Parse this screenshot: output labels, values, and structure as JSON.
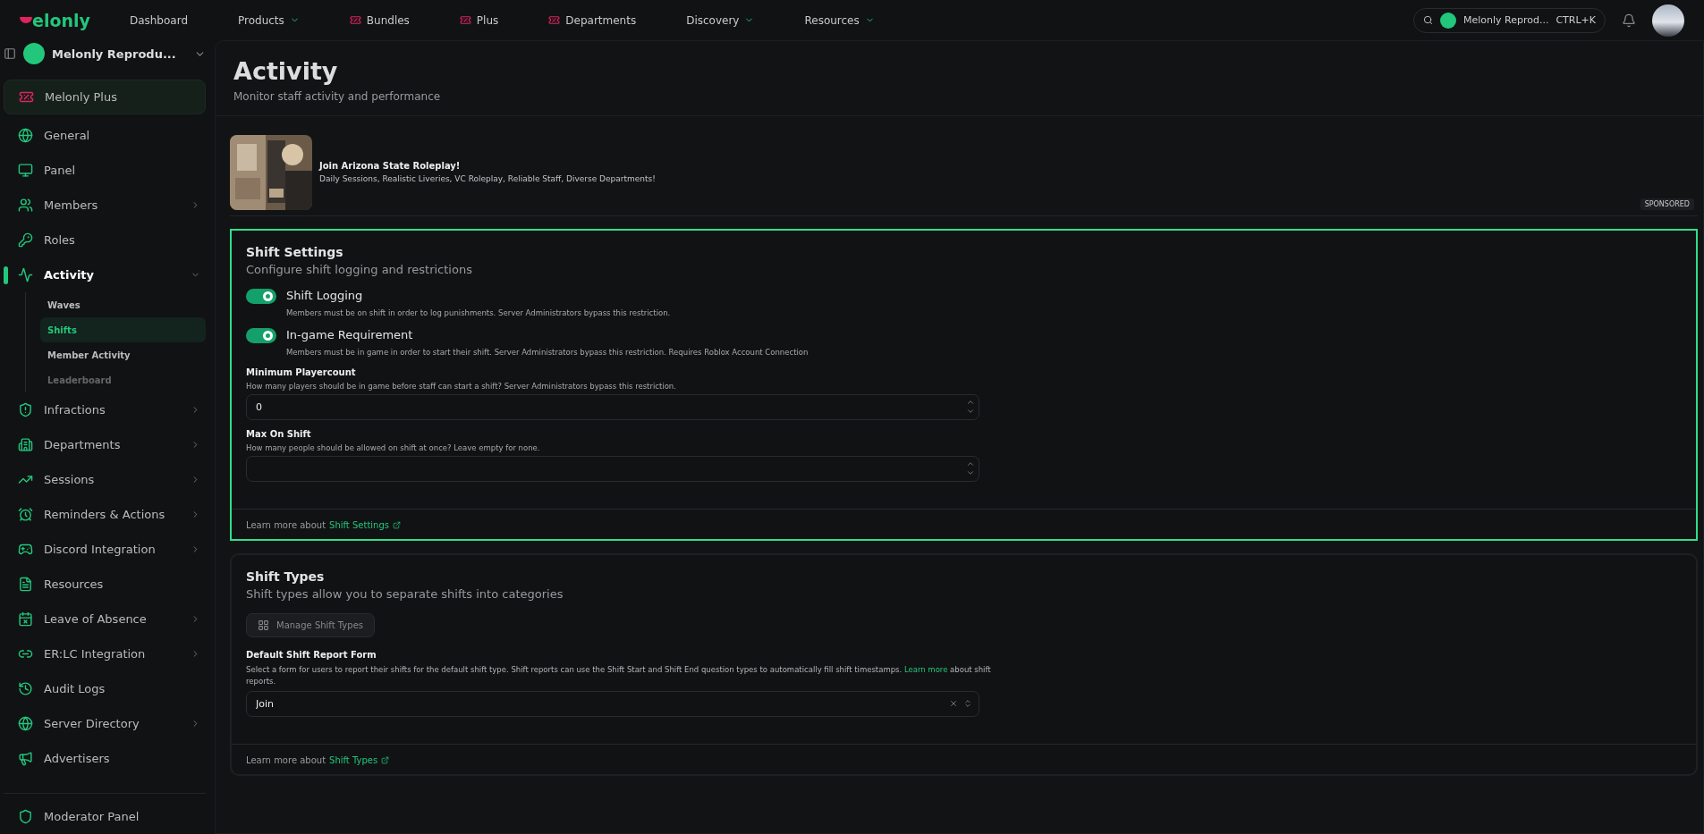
{
  "nav": {
    "logo_text": "elonly",
    "items": [
      {
        "label": "Dashboard",
        "kind": "link"
      },
      {
        "label": "Products",
        "kind": "menu"
      },
      {
        "label": "Bundles",
        "kind": "featured"
      },
      {
        "label": "Plus",
        "kind": "featured"
      },
      {
        "label": "Departments",
        "kind": "featured"
      },
      {
        "label": "Discovery",
        "kind": "menu"
      },
      {
        "label": "Resources",
        "kind": "menu"
      }
    ],
    "server_switcher": {
      "name": "Melonly Reprod...",
      "shortcut": "CTRL+K"
    }
  },
  "sidebar": {
    "server": "Melonly Reprodu...",
    "items": [
      {
        "label": "Melonly Plus",
        "kind": "promo",
        "selected": false
      },
      {
        "label": "General",
        "kind": "link",
        "selected": false
      },
      {
        "label": "Panel",
        "kind": "link",
        "selected": false
      },
      {
        "label": "Members",
        "kind": "group",
        "expanded": false,
        "selected": false
      },
      {
        "label": "Roles",
        "kind": "link",
        "selected": false
      },
      {
        "label": "Activity",
        "kind": "group",
        "expanded": true,
        "selected": true,
        "children": [
          {
            "label": "Waves",
            "selected": false,
            "disabled": false
          },
          {
            "label": "Shifts",
            "selected": true,
            "disabled": false
          },
          {
            "label": "Member Activity",
            "selected": false,
            "disabled": false
          },
          {
            "label": "Leaderboard",
            "selected": false,
            "disabled": true
          }
        ]
      },
      {
        "label": "Infractions",
        "kind": "group",
        "expanded": false,
        "selected": false
      },
      {
        "label": "Departments",
        "kind": "group",
        "expanded": false,
        "selected": false
      },
      {
        "label": "Sessions",
        "kind": "group",
        "expanded": false,
        "selected": false
      },
      {
        "label": "Reminders & Actions",
        "kind": "group",
        "expanded": false,
        "selected": false
      },
      {
        "label": "Discord Integration",
        "kind": "group",
        "expanded": false,
        "selected": false
      },
      {
        "label": "Resources",
        "kind": "link",
        "selected": false
      },
      {
        "label": "Leave of Absence",
        "kind": "group",
        "expanded": false,
        "selected": false
      },
      {
        "label": "ER:LC Integration",
        "kind": "group",
        "expanded": false,
        "selected": false
      },
      {
        "label": "Audit Logs",
        "kind": "link",
        "selected": false
      },
      {
        "label": "Server Directory",
        "kind": "group",
        "expanded": false,
        "selected": false
      },
      {
        "label": "Advertisers",
        "kind": "link",
        "selected": false
      }
    ],
    "footer": "Moderator Panel"
  },
  "page": {
    "title": "Activity",
    "subtitle": "Monitor staff activity and performance"
  },
  "ad": {
    "kind": "picture",
    "title": "Join Arizona State Roleplay!",
    "text": "Daily Sessions, Realistic Liveries, VC Roleplay, Reliable Staff, Diverse Departments!",
    "badge": "SPONSORED"
  },
  "shift_settings": {
    "title": "Shift Settings",
    "subtitle": "Configure shift logging and restrictions",
    "toggles": [
      {
        "label": "Shift Logging",
        "description": "Members must be on shift in order to log punishments. Server Administrators bypass this restriction.",
        "on": true
      },
      {
        "label": "In-game Requirement",
        "description": "Members must be in game in order to start their shift. Server Administrators bypass this restriction. Requires Roblox Account Connection",
        "on": true
      }
    ],
    "fields": [
      {
        "label": "Minimum Playercount",
        "description": "How many players should be in game before staff can start a shift? Server Administrators bypass this restriction.",
        "value": "0"
      },
      {
        "label": "Max On Shift",
        "description": "How many people should be allowed on shift at once? Leave empty for none."
      }
    ],
    "footer_text": "Learn more about",
    "footer_link": "Shift Settings"
  },
  "shift_types": {
    "title": "Shift Types",
    "subtitle": "Shift types allow you to separate shifts into categories",
    "button": "Manage Shift Types",
    "form_label": "Default Shift Report Form",
    "form_description": "Select a form for users to report their shifts for the default shift type. Shift reports can use the Shift Start and Shift End question types to automatically fill shift timestamps.",
    "form_link": "Learn more",
    "form_link_after": "about shift reports.",
    "form_value": "Join",
    "footer_text": "Learn more about",
    "footer_link": "Shift Types"
  }
}
